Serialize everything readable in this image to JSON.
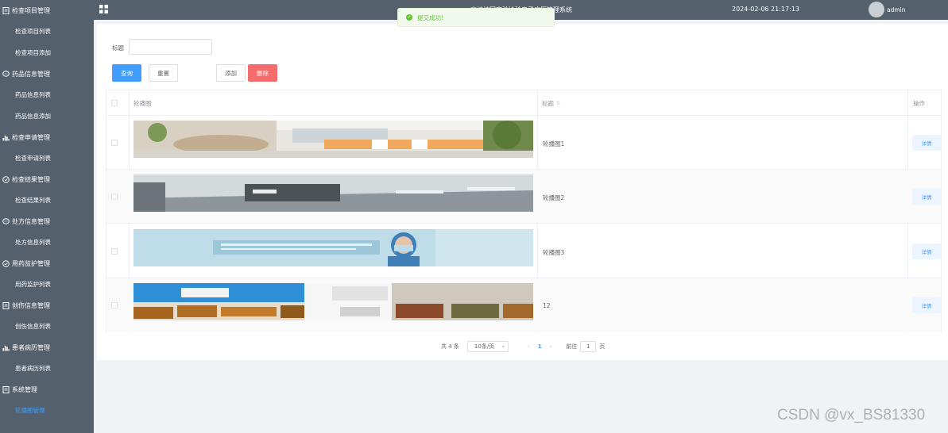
{
  "sidebar": {
    "groups": [
      {
        "label": "检查项目管理",
        "icon": "list-icon",
        "items": [
          "检查项目列表",
          "检查项目添加"
        ]
      },
      {
        "label": "药品信息管理",
        "icon": "chat-icon",
        "items": [
          "药品信息列表",
          "药品信息添加"
        ]
      },
      {
        "label": "检查申请管理",
        "icon": "bar-chart-icon",
        "items": [
          "检查申请列表"
        ]
      },
      {
        "label": "检查结果管理",
        "icon": "check-circle-icon",
        "items": [
          "检查结果列表"
        ]
      },
      {
        "label": "处方信息管理",
        "icon": "chat-icon",
        "items": [
          "处方信息列表"
        ]
      },
      {
        "label": "用药监护管理",
        "icon": "check-circle-icon",
        "items": [
          "用药监护列表"
        ]
      },
      {
        "label": "创伤信息管理",
        "icon": "list-icon",
        "items": [
          "创伤信息列表"
        ]
      },
      {
        "label": "患者病历管理",
        "icon": "bar-chart-icon",
        "items": [
          "患者病历列表"
        ]
      },
      {
        "label": "系统管理",
        "icon": "list-icon",
        "items": [
          "轮播图管理"
        ]
      }
    ],
    "active_item": "轮播图管理"
  },
  "topbar": {
    "title": "高校校园实验检验电子病历管理系统",
    "datetime": "2024-02-06 21:17:13",
    "username": "admin"
  },
  "toast": {
    "message": "提交成功!"
  },
  "search": {
    "label": "标题",
    "value": ""
  },
  "buttons": {
    "search": "查询",
    "reset": "重置",
    "add": "添加",
    "delete": "删除"
  },
  "table": {
    "columns": {
      "image": "轮播图",
      "title": "标题",
      "actions": "操作"
    },
    "rows": [
      {
        "title": "轮播图1",
        "action": "详情"
      },
      {
        "title": "轮播图2",
        "action": "详情"
      },
      {
        "title": "轮播图3",
        "action": "详情"
      },
      {
        "title": "12",
        "action": "详情"
      }
    ]
  },
  "pagination": {
    "total": "共 4 条",
    "page_size": "10条/页",
    "current_page": "1",
    "goto_label": "前往",
    "goto_value": "1",
    "page_suffix": "页"
  },
  "watermark": "CSDN @vx_BS81330",
  "colors": {
    "sidebar": "#54606c",
    "primary": "#409eff",
    "danger": "#f56c6c",
    "success": "#67c23a"
  }
}
